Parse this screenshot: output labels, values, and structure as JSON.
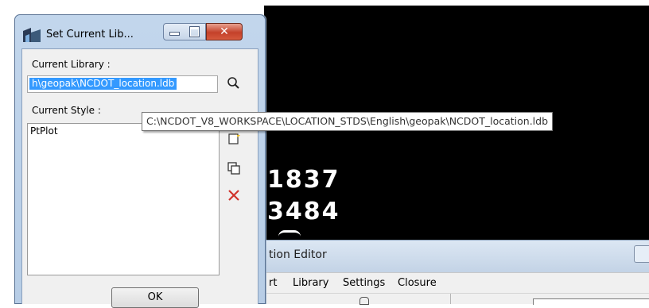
{
  "dialog": {
    "title": "Set Current Lib...",
    "current_library_label": "Current Library :",
    "current_library_value": "h\\geopak\\NCDOT_location.ldb",
    "current_style_label": "Current Style :",
    "style_items": [
      "PtPlot"
    ],
    "ok_label": "OK",
    "icons": [
      "app-icon",
      "minimize-icon",
      "maximize-icon",
      "close-icon",
      "search-icon",
      "new-icon",
      "copy-icon",
      "delete-icon"
    ]
  },
  "tooltip": {
    "text": "C:\\NCDOT_V8_WORKSPACE\\LOCATION_STDS\\English\\geopak\\NCDOT_location.ldb"
  },
  "cad_view": {
    "values": [
      "1837",
      "3484"
    ]
  },
  "background_window": {
    "title": "tion Editor",
    "menu": [
      "rt",
      "Library",
      "Settings",
      "Closure"
    ]
  },
  "colors": {
    "selection": "#3399ff",
    "close_button": "#c4412a",
    "delete_icon": "#d0342c",
    "cad_background": "#000000"
  }
}
